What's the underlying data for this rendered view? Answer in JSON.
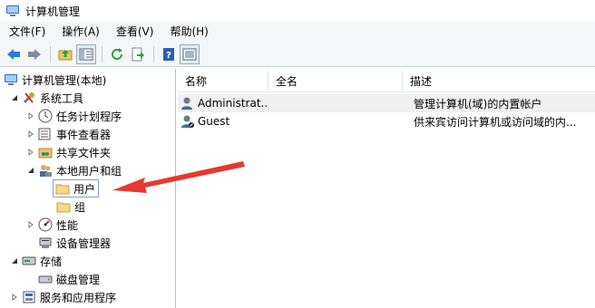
{
  "window": {
    "title": "计算机管理"
  },
  "menu": [
    "文件(F)",
    "操作(A)",
    "查看(V)",
    "帮助(H)"
  ],
  "tree": {
    "root": "计算机管理(本地)",
    "system_tools": "系统工具",
    "task_scheduler": "任务计划程序",
    "event_viewer": "事件查看器",
    "shared_folders": "共享文件夹",
    "local_users_groups": "本地用户和组",
    "users": "用户",
    "groups": "组",
    "performance": "性能",
    "device_manager": "设备管理器",
    "storage": "存储",
    "disk_management": "磁盘管理",
    "services_apps": "服务和应用程序"
  },
  "list": {
    "columns": [
      "名称",
      "全名",
      "描述"
    ],
    "rows": [
      {
        "name": "Administrat...",
        "fullname": "",
        "description": "管理计算机(域)的内置帐户"
      },
      {
        "name": "Guest",
        "fullname": "",
        "description": "供来宾访问计算机或访问域的内..."
      }
    ]
  },
  "colors": {
    "arrow": "#e8382f",
    "selection_border": "#7da2ce",
    "toolbar_bg": "#f5f6f7"
  },
  "icons": [
    "computer-icon",
    "back-icon",
    "forward-icon",
    "up-folder-icon",
    "show-hide-tree-icon",
    "refresh-icon",
    "export-icon",
    "help-icon",
    "properties-icon",
    "user-icon",
    "guest-icon"
  ]
}
